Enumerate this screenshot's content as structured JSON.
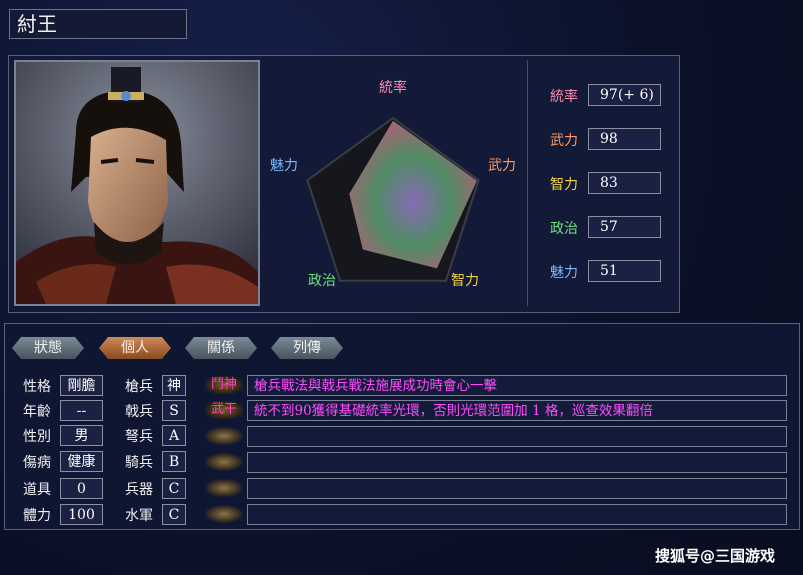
{
  "character": {
    "name": "紂王"
  },
  "radar": {
    "labels": {
      "tongshuai": "統率",
      "wuli": "武力",
      "zhili": "智力",
      "zhengzhi": "政治",
      "meili": "魅力"
    },
    "values": [
      97,
      98,
      83,
      57,
      51
    ],
    "max": 100
  },
  "stats": [
    {
      "label": "統率",
      "value": "97(+ 6)",
      "color": "#ff8ab0"
    },
    {
      "label": "武力",
      "value": "98",
      "color": "#ff9a66"
    },
    {
      "label": "智力",
      "value": "83",
      "color": "#f2d24a"
    },
    {
      "label": "政治",
      "value": "57",
      "color": "#6ee07a"
    },
    {
      "label": "魅力",
      "value": "51",
      "color": "#7ab8ff"
    }
  ],
  "tabs": [
    {
      "label": "狀態",
      "active": false
    },
    {
      "label": "個人",
      "active": true
    },
    {
      "label": "關係",
      "active": false
    },
    {
      "label": "列傳",
      "active": false
    }
  ],
  "personal": [
    {
      "label": "性格",
      "value": "剛膽"
    },
    {
      "label": "年齡",
      "value": "--"
    },
    {
      "label": "性別",
      "value": "男"
    },
    {
      "label": "傷病",
      "value": "健康"
    },
    {
      "label": "道具",
      "value": "0"
    },
    {
      "label": "體力",
      "value": "100"
    }
  ],
  "aptitude": [
    {
      "label": "槍兵",
      "value": "神"
    },
    {
      "label": "戟兵",
      "value": "S"
    },
    {
      "label": "弩兵",
      "value": "A"
    },
    {
      "label": "騎兵",
      "value": "B"
    },
    {
      "label": "兵器",
      "value": "C"
    },
    {
      "label": "水軍",
      "value": "C"
    }
  ],
  "skills": [
    {
      "name": "鬥神",
      "desc": "槍兵戰法與戟兵戰法施展成功時會心一擊"
    },
    {
      "name": "武干",
      "desc": "統不到90獲得基礎統率光環，否則光環范圍加 1 格，巡查效果翻倍"
    },
    {
      "name": "",
      "desc": ""
    },
    {
      "name": "",
      "desc": ""
    },
    {
      "name": "",
      "desc": ""
    },
    {
      "name": "",
      "desc": ""
    }
  ],
  "watermark": "搜狐号@三国游戏"
}
